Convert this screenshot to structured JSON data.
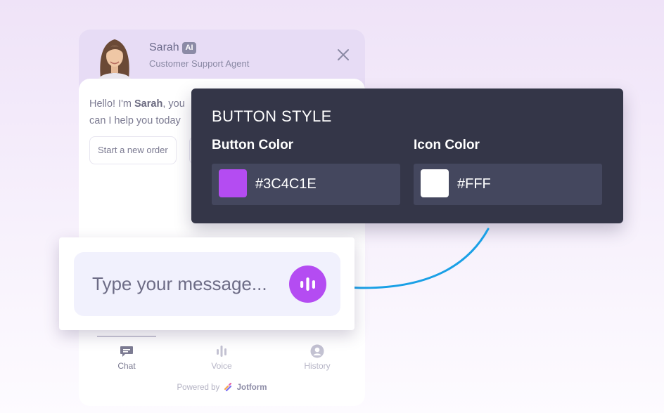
{
  "agent": {
    "name": "Sarah",
    "badge": "AI",
    "role": "Customer Support Agent"
  },
  "chat": {
    "greeting_prefix": "Hello! I'm ",
    "greeting_name": "Sarah",
    "greeting_suffix": ", you",
    "greeting_line2": "can I help you today",
    "suggestion": "Start a new order"
  },
  "style_panel": {
    "title": "BUTTON STYLE",
    "button_color": {
      "label": "Button Color",
      "value": "#3C4C1E",
      "swatch_hex": "#b44cf2"
    },
    "icon_color": {
      "label": "Icon Color",
      "value": "#FFF",
      "swatch_hex": "#ffffff"
    }
  },
  "composer": {
    "placeholder": "Type your message...",
    "send_icon": "voice-bars-icon",
    "accent": "#b44cf2"
  },
  "nav": {
    "items": [
      {
        "label": "Chat",
        "icon": "chat-icon",
        "active": true
      },
      {
        "label": "Voice",
        "icon": "voice-bars-icon",
        "active": false
      },
      {
        "label": "History",
        "icon": "user-circle-icon",
        "active": false
      }
    ]
  },
  "footer": {
    "powered_by": "Powered by",
    "brand": "Jotform"
  }
}
